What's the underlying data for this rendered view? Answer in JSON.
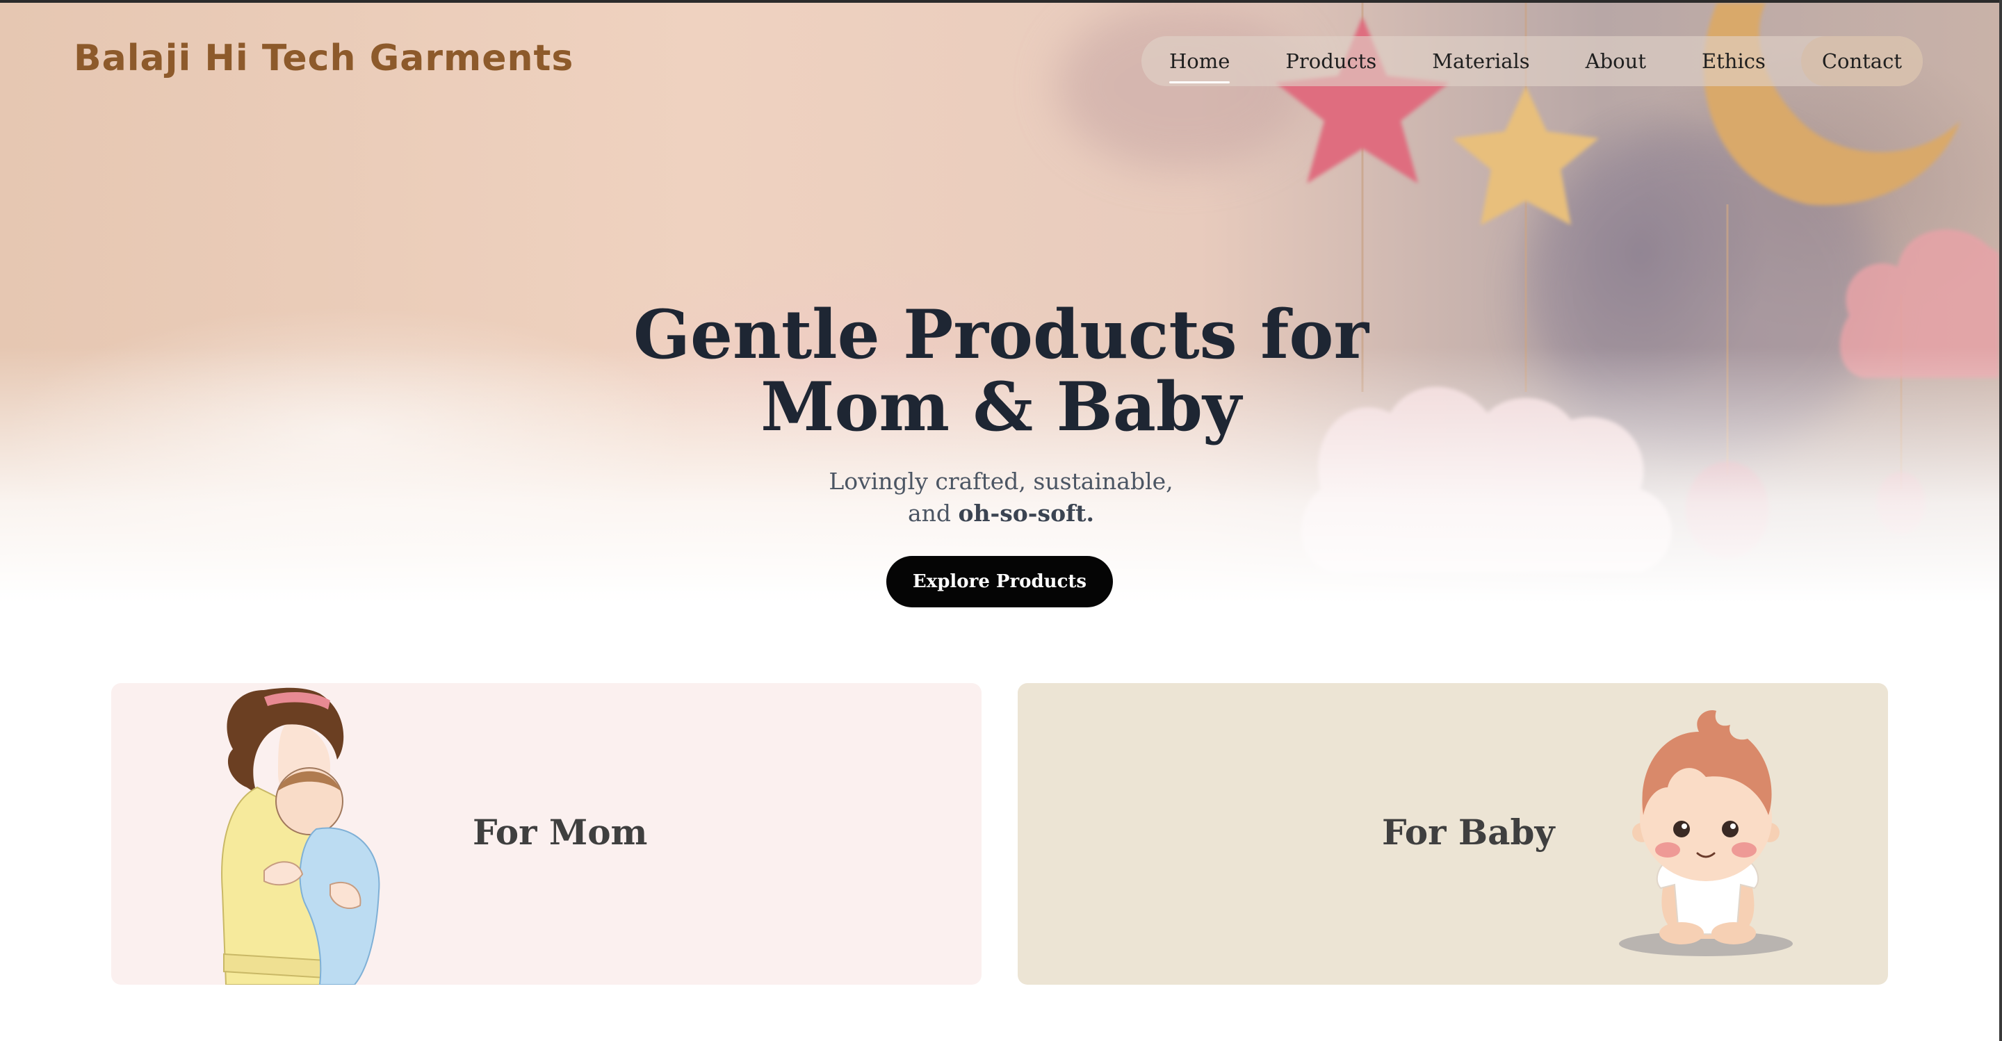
{
  "brand": {
    "name": "Balaji Hi Tech Garments"
  },
  "nav": {
    "items": [
      {
        "label": "Home",
        "active": true
      },
      {
        "label": "Products",
        "active": false
      },
      {
        "label": "Materials",
        "active": false
      },
      {
        "label": "About",
        "active": false
      },
      {
        "label": "Ethics",
        "active": false
      },
      {
        "label": "Contact",
        "active": false
      }
    ]
  },
  "hero": {
    "title_line1": "Gentle Products for",
    "title_line2": "Mom & Baby",
    "subtitle_line1": "Lovingly crafted, sustainable,",
    "subtitle_line2_prefix": "and",
    "subtitle_line2_bold": "oh-so-soft.",
    "cta_label": "Explore Products"
  },
  "categories": [
    {
      "label": "For Mom",
      "illustration": "mother-holding-baby-illustration",
      "background": "#fbf0ef"
    },
    {
      "label": "For Baby",
      "illustration": "cartoon-baby-illustration",
      "background": "#ece4d4"
    }
  ],
  "colors": {
    "brand": "#8d5a2b",
    "heading": "#1e2633",
    "cta_background": "#050505"
  }
}
